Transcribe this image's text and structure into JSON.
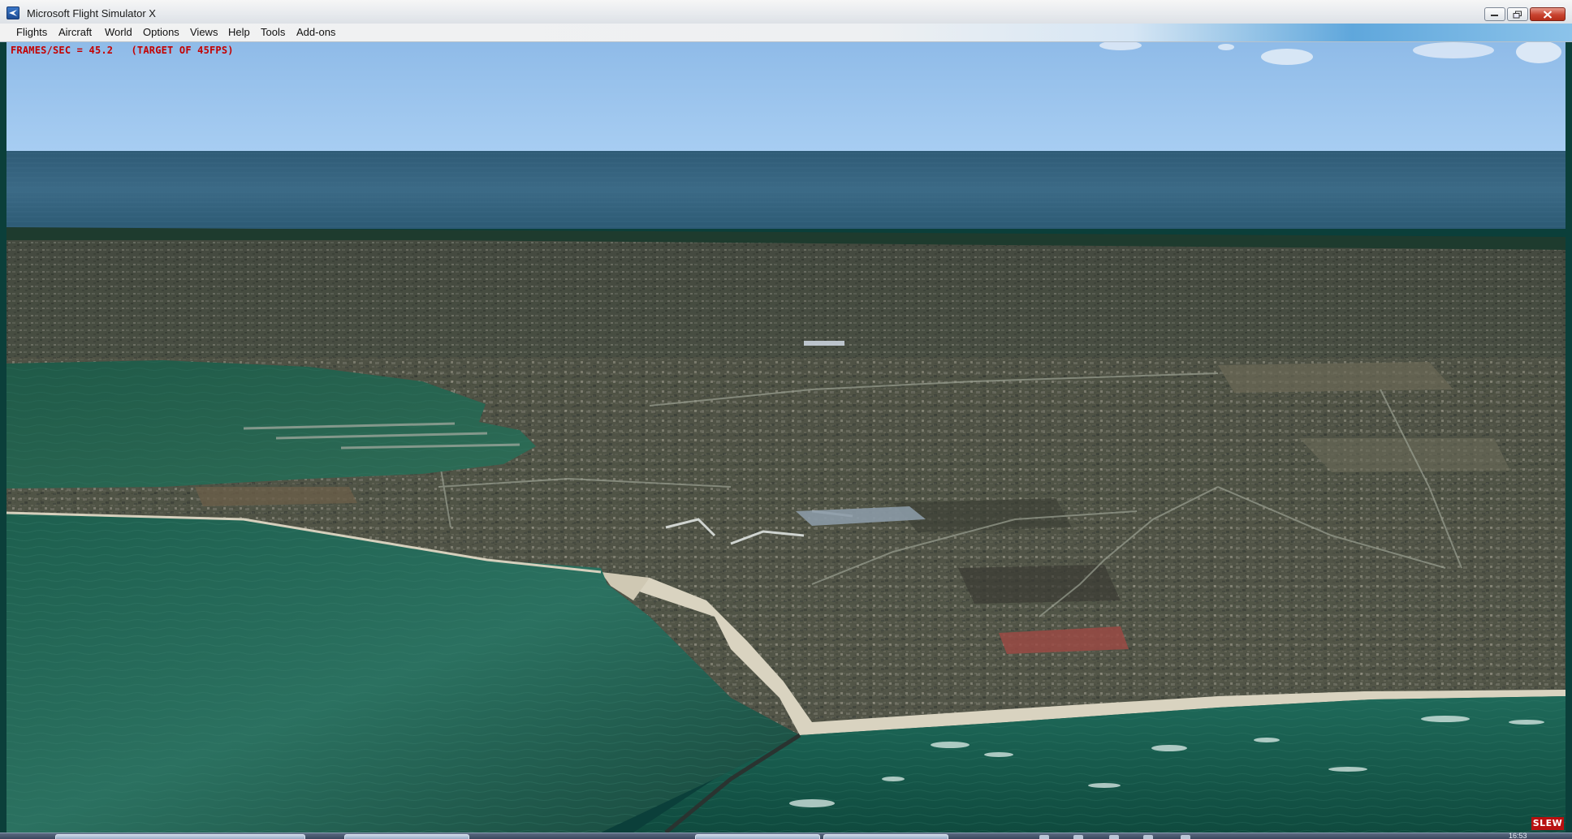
{
  "window": {
    "title": "Microsoft Flight Simulator X",
    "icon": "fsx-app-icon"
  },
  "menu": [
    {
      "label": "Flights"
    },
    {
      "label": "Aircraft"
    },
    {
      "label": "World"
    },
    {
      "label": "Options"
    },
    {
      "label": "Views"
    },
    {
      "label": "Help"
    },
    {
      "label": "Tools"
    },
    {
      "label": "Add-ons"
    }
  ],
  "overlay": {
    "fps_text": "FRAMES/SEC = 45.2   (TARGET OF 45FPS)",
    "fps_color": "#c40000",
    "slew_label": "SLEW",
    "slew_color": "#b81010"
  },
  "taskbar": {
    "clock": "16:53"
  }
}
